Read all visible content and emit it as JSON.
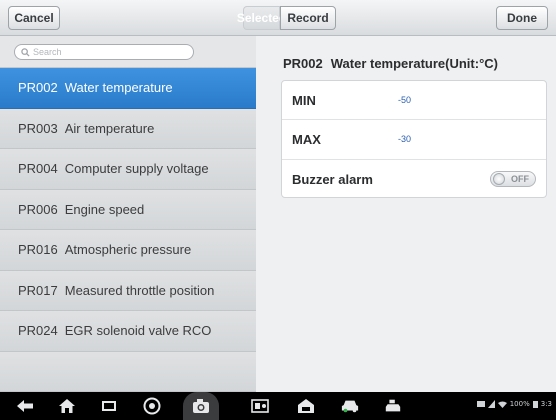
{
  "toolbar": {
    "cancel_label": "Cancel",
    "selected_label": "Selected",
    "record_label": "Record",
    "done_label": "Done"
  },
  "search": {
    "placeholder": "Search"
  },
  "parameters": [
    {
      "code": "PR002",
      "name": "Water temperature",
      "selected": true
    },
    {
      "code": "PR003",
      "name": "Air temperature",
      "selected": false
    },
    {
      "code": "PR004",
      "name": "Computer supply voltage",
      "selected": false
    },
    {
      "code": "PR006",
      "name": "Engine speed",
      "selected": false
    },
    {
      "code": "PR016",
      "name": "Atmospheric pressure",
      "selected": false
    },
    {
      "code": "PR017",
      "name": "Measured throttle position",
      "selected": false
    },
    {
      "code": "PR024",
      "name": "EGR solenoid valve RCO",
      "selected": false
    },
    {
      "code": "",
      "name": "",
      "selected": false
    }
  ],
  "detail": {
    "code": "PR002",
    "title": "Water temperature(Unit:°C)",
    "min_label": "MIN",
    "min_value": "-50",
    "max_label": "MAX",
    "max_value": "-30",
    "buzzer_label": "Buzzer alarm",
    "buzzer_state": "OFF"
  },
  "status": {
    "battery": "100%",
    "time": "3:3"
  },
  "colors": {
    "selected_row": "#2f84d3",
    "value_text": "#2a5fb0"
  },
  "icons": [
    "back-icon",
    "home-icon",
    "recent-apps-icon",
    "browser-icon",
    "camera-icon",
    "screen-record-icon",
    "car-home-icon",
    "vehicle-icon",
    "vehicle-connect-icon"
  ]
}
